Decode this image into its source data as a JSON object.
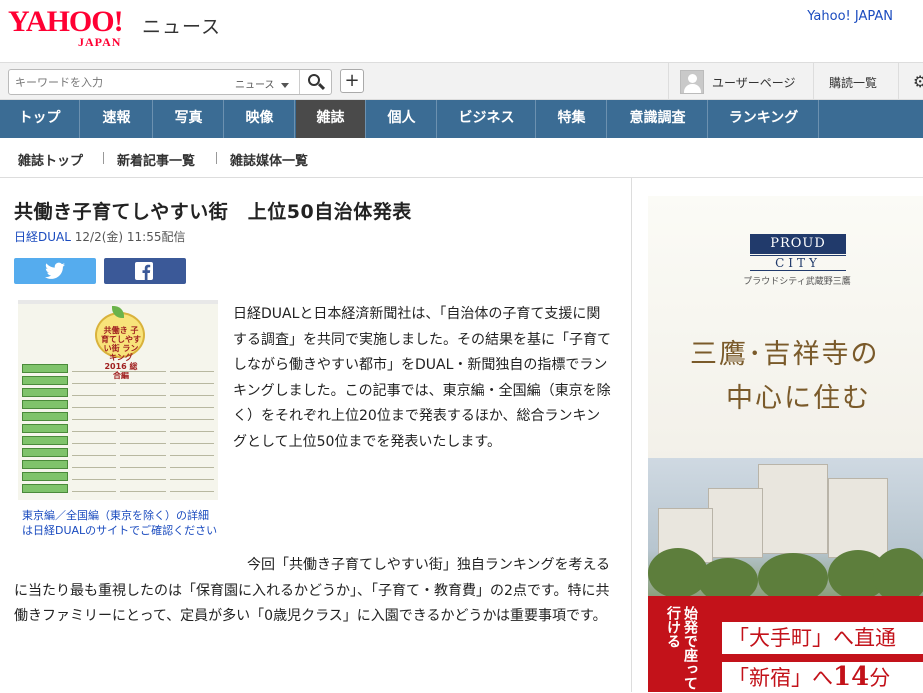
{
  "header": {
    "logo_text": "YAHOO!",
    "logo_sub": "JAPAN",
    "service": "ニュース",
    "top_link": "Yahoo! JAPAN"
  },
  "search": {
    "placeholder": "キーワードを入力",
    "scope": "ニュース",
    "plus": "+"
  },
  "user": {
    "user_page": "ユーザーページ",
    "subscribe": "購読一覧"
  },
  "nav": {
    "tabs": [
      "トップ",
      "速報",
      "写真",
      "映像",
      "雑誌",
      "個人",
      "ビジネス",
      "特集",
      "意識調査",
      "ランキング"
    ],
    "active": "雑誌"
  },
  "subnav": {
    "items": [
      "雑誌トップ",
      "新着記事一覧",
      "雑誌媒体一覧"
    ]
  },
  "article": {
    "title": "共働き子育てしやすい街　上位50自治体発表",
    "source": "日経DUAL",
    "date": "12/2(金) 11:55配信",
    "photo_caption": "東京編／全国編（東京を除く）の詳細は日経DUALのサイトでご確認ください",
    "photo_medal_text": "共働き 子育てしやすい街 ランキング2016 総合編",
    "para1": "日経DUALと日本経済新聞社は、「自治体の子育て支援に関する調査」を共同で実施しました。その結果を基に「子育てしながら働きやすい都市」をDUAL・新聞独自の指標でランキングしました。この記事では、東京編・全国編（東京を除く）をそれぞれ上位20位まで発表するほか、総合ランキングとして上位50位までを発表いたします。",
    "para2": "今回「共働き子育てしやすい街」独自ランキングを考えるに当たり最も重視したのは「保育園に入れるかどうか」、「子育て・教育費」の2点です。特に共働きファミリーにとって、定員が多い「0歳児クラス」に入園できるかどうかは重要事項です。"
  },
  "ad": {
    "brand": "PROUD",
    "city": "CITY",
    "sub": "プラウドシティ武蔵野三鷹",
    "headline1": "三鷹･吉祥寺の",
    "headline2": "中心に住む",
    "vertical_text": "始発で座って行ける",
    "box1": "「大手町」へ直通",
    "box2_prefix": "「新宿」へ",
    "box2_num": "14",
    "box2_unit": "分"
  },
  "colors": {
    "nav_bg": "#3b6c94",
    "nav_active": "#4a4a4a",
    "logo_red": "#ff0033",
    "link_blue": "#1a4bbf",
    "twitter": "#55acee",
    "facebook": "#3b5998",
    "ad_red": "#c3121a"
  }
}
